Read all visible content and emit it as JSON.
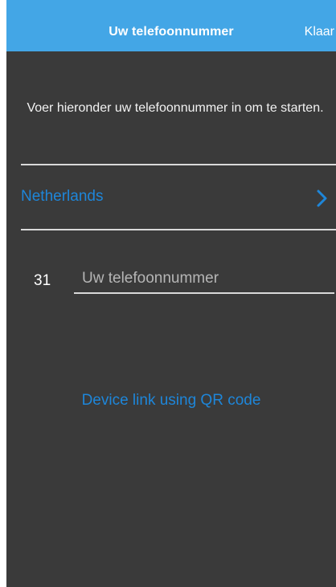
{
  "navbar": {
    "title": "Uw telefoonnummer",
    "done_label": "Klaar"
  },
  "instruction": "Voer hieronder uw telefoonnummer in om te starten.",
  "country": {
    "name": "Netherlands",
    "icon": "chevron-right-icon"
  },
  "phone": {
    "country_code": "31",
    "value": "",
    "placeholder": "Uw telefoonnummer"
  },
  "qr_link_label": "Device link using QR code",
  "colors": {
    "navbar": "#43a6e6",
    "background": "#3a3a3a",
    "accent": "#1e86d9"
  }
}
